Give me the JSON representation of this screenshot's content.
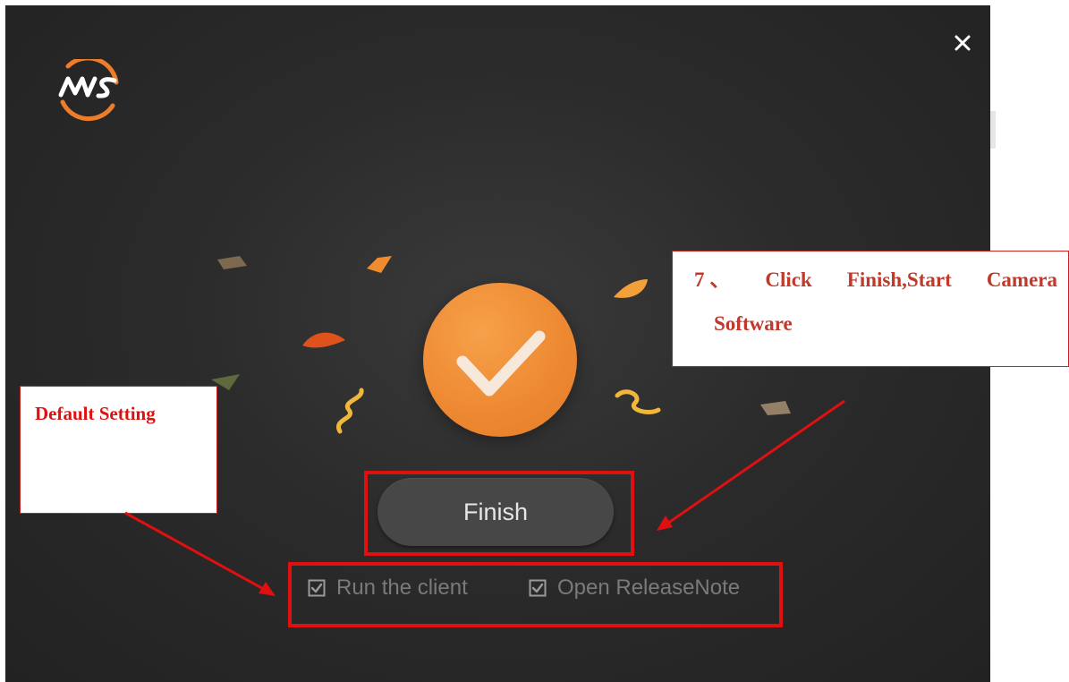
{
  "window": {
    "close_icon": "close-icon",
    "logo_text": "MVS",
    "logo_icon": "mvs-logo"
  },
  "main": {
    "status_icon": "checkmark-icon",
    "finish_label": "Finish",
    "options": [
      {
        "label": "Run the client",
        "checked": true
      },
      {
        "label": "Open ReleaseNote",
        "checked": true
      }
    ]
  },
  "annotations": {
    "default_setting": "Default Setting",
    "step_line1_num": "7",
    "step_line1_sep": "、",
    "step_line1_w1": "Click",
    "step_line1_w2": "Finish,Start",
    "step_line1_w3": "Camera",
    "step_line2": "Software"
  },
  "colors": {
    "accent_orange": "#ee8a33",
    "annotation_red": "#e01010",
    "background_dark": "#2b2b2b"
  }
}
